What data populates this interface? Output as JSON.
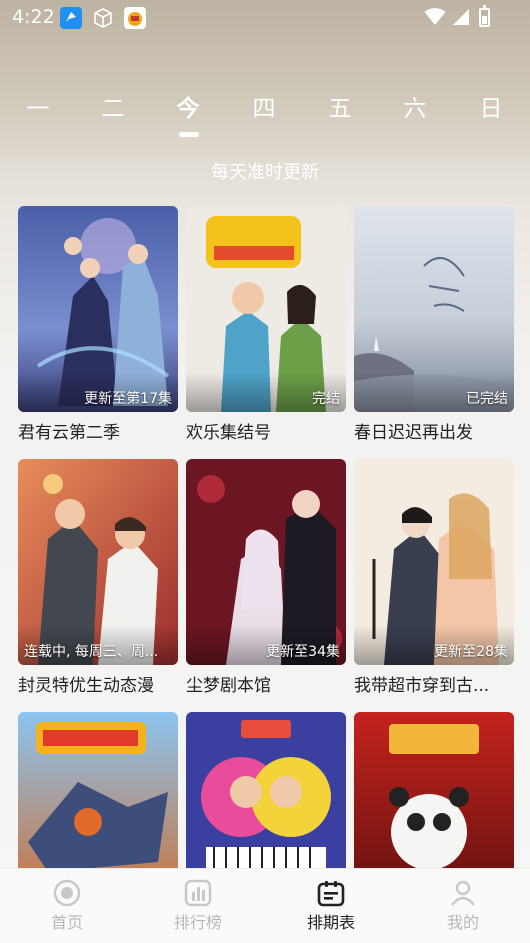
{
  "status_bar": {
    "time": "4:22"
  },
  "day_tabs": [
    {
      "label": "一"
    },
    {
      "label": "二"
    },
    {
      "label": "今"
    },
    {
      "label": "四"
    },
    {
      "label": "五"
    },
    {
      "label": "六"
    },
    {
      "label": "日"
    }
  ],
  "active_day_index": 2,
  "subtitle": "每天准时更新",
  "shows": [
    {
      "title": "君有云第二季",
      "badge": "更新至第17集",
      "icon": "cover-fantasy-warriors"
    },
    {
      "title": "欢乐集结号",
      "badge": "完结",
      "icon": "cover-variety-hosts"
    },
    {
      "title": "春日迟迟再出发",
      "badge": "已完结",
      "icon": "cover-misty-coast"
    },
    {
      "title": "封灵特优生动态漫",
      "badge": "连载中, 每周三、周...",
      "icon": "cover-two-boys"
    },
    {
      "title": "尘梦剧本馆",
      "badge": "更新至34集",
      "icon": "cover-couple-roses"
    },
    {
      "title": "我带超市穿到古...",
      "badge": "更新至28集",
      "icon": "cover-ancient-couple"
    },
    {
      "title": "",
      "badge": "",
      "icon": "cover-adventure-island"
    },
    {
      "title": "",
      "badge": "",
      "icon": "cover-comedy-duo"
    },
    {
      "title": "",
      "badge": "",
      "icon": "cover-kung-fu-panda"
    }
  ],
  "bottom_nav": [
    {
      "label": "首页",
      "icon": "home-icon"
    },
    {
      "label": "排行榜",
      "icon": "ranking-icon"
    },
    {
      "label": "排期表",
      "icon": "schedule-icon"
    },
    {
      "label": "我的",
      "icon": "profile-icon"
    }
  ],
  "active_nav_index": 2,
  "colors": {
    "active_text": "#222222",
    "inactive_text": "#b8b8b8",
    "badge_text": "#ffffff"
  }
}
